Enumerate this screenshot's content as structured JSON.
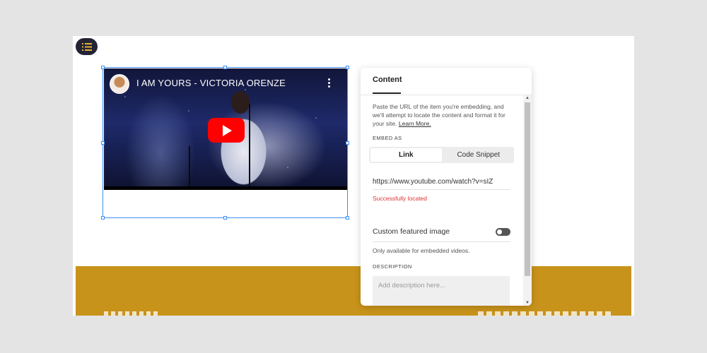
{
  "video": {
    "title": "I AM YOURS - VICTORIA ORENZE"
  },
  "panel": {
    "tab_label": "Content",
    "help_text": "Paste the URL of the item you're embedding, and we'll attempt to locate the content and format it for your site.",
    "help_link": "Learn More.",
    "embed_as_label": "EMBED AS",
    "embed_options": [
      "Link",
      "Code Snippet"
    ],
    "embed_selected": "Link",
    "url_value": "https://www.youtube.com/watch?v=sIZ",
    "status_text": "Successfully located",
    "custom_image_label": "Custom featured image",
    "custom_image_enabled": false,
    "custom_image_help": "Only available for embedded videos.",
    "description_label": "DESCRIPTION",
    "description_placeholder": "Add description here..."
  },
  "colors": {
    "accent": "#3d8ff5",
    "band": "#c8931a",
    "status_success": "#dd3333",
    "play_button": "#ff0000"
  }
}
